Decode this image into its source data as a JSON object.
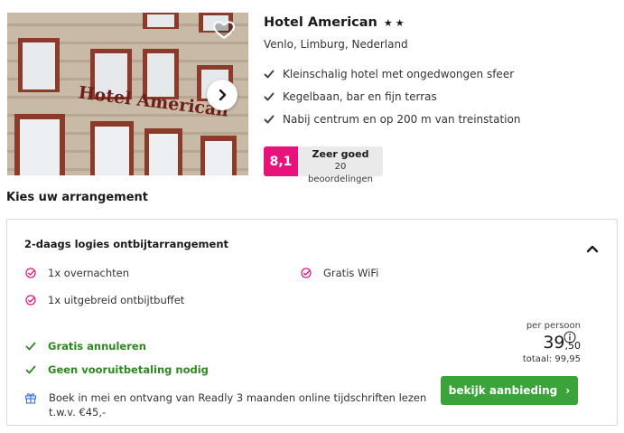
{
  "hotel": {
    "name": "Hotel American",
    "stars": "★★",
    "location": "Venlo, Limburg, Nederland",
    "photo_sign_text": "Hotel American",
    "usps": [
      "Kleinschalig hotel met ongedwongen sfeer",
      "Kegelbaan, bar en fijn terras",
      "Nabij centrum en op 200 m van treinstation"
    ],
    "rating": {
      "score": "8,1",
      "label": "Zeer goed",
      "count": "20 beoordelingen"
    }
  },
  "section_title": "Kies uw arrangement",
  "arrangement": {
    "title": "2-daags logies ontbijtarrangement",
    "features": [
      "1x overnachten",
      "Gratis WiFi",
      "1x uitgebreid ontbijtbuffet"
    ],
    "policies": [
      "Gratis annuleren",
      "Geen vooruitbetaling nodig"
    ],
    "promo": "Boek in mei en ontvang van Readly 3 maanden online tijdschriften lezen t.w.v. €45,-",
    "price": {
      "per_person_label": "per persoon",
      "amount_main": "39",
      "amount_cents": ",50",
      "total": "totaal: 99,95"
    },
    "cta_label": "bekijk aanbieding",
    "cta_chevron": "›"
  },
  "colors": {
    "rating_accent": "#e8127b",
    "success_green": "#2b8a1e",
    "cta_green": "#3aa43a",
    "feature_pink": "#e8127b"
  },
  "icons": {
    "favorite": "heart-icon",
    "next_photo": "chevron-right-icon",
    "usp_check": "check-icon",
    "feature_check": "check-circle-icon",
    "collapse": "chevron-up-icon",
    "info": "info-icon",
    "promo": "gift-icon"
  }
}
